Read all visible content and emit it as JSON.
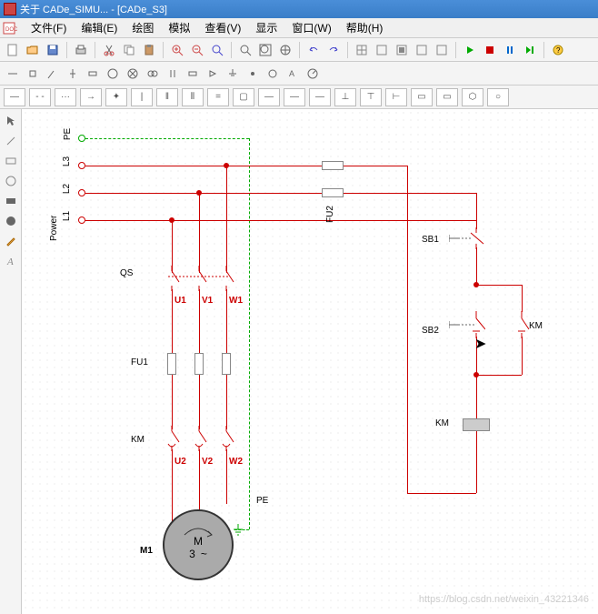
{
  "titlebar": {
    "text": "关于 CADe_SIMU... - [CADe_S3]"
  },
  "menubar": {
    "items": [
      {
        "label": "文件(F)"
      },
      {
        "label": "编辑(E)"
      },
      {
        "label": "绘图"
      },
      {
        "label": "模拟"
      },
      {
        "label": "查看(V)"
      },
      {
        "label": "显示"
      },
      {
        "label": "窗口(W)"
      },
      {
        "label": "帮助(H)"
      }
    ]
  },
  "circuit": {
    "pe_label": "PE",
    "power_labels": [
      "PE",
      "L3",
      "L2",
      "L1"
    ],
    "power_text": "Power",
    "qs_label": "QS",
    "u1": "U1",
    "v1": "V1",
    "w1": "W1",
    "u2": "U2",
    "v2": "V2",
    "w2": "W2",
    "fu1": "FU1",
    "fu2": "FU2",
    "km_left": "KM",
    "km_right": "KM",
    "km_coil": "KM",
    "sb1": "SB1",
    "sb2": "SB2",
    "pe_bottom": "PE",
    "m1": "M1",
    "motor_m": "M",
    "motor_3": "3",
    "motor_tilde": "~"
  },
  "watermark": "https://blog.csdn.net/weixin_43221346"
}
